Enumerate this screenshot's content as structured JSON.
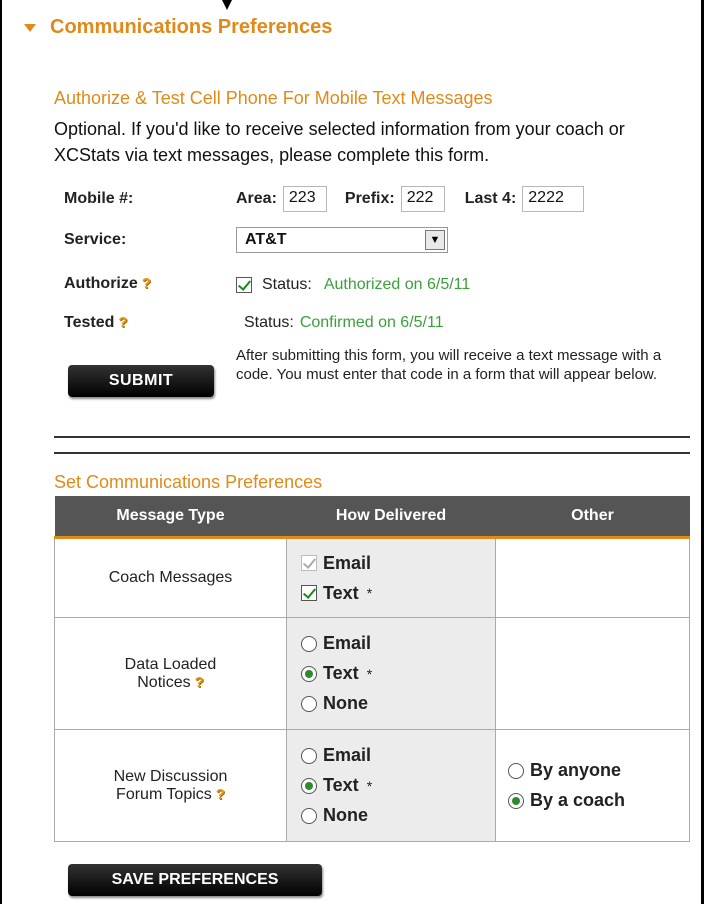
{
  "section": {
    "title": "Communications Preferences"
  },
  "phone": {
    "subtitle": "Authorize & Test Cell Phone For Mobile Text Messages",
    "intro": "Optional. If you'd like to receive selected information from your coach or XCStats via text messages, please complete this form.",
    "mobile_label": "Mobile #:",
    "area_label": "Area:",
    "area_value": "223",
    "prefix_label": "Prefix:",
    "prefix_value": "222",
    "last4_label": "Last 4:",
    "last4_value": "2222",
    "service_label": "Service:",
    "service_value": "AT&T",
    "authorize_label": "Authorize",
    "authorize_status_label": "Status:",
    "authorize_status_value": "Authorized on 6/5/11",
    "tested_label": "Tested",
    "tested_status_label": "Status:",
    "tested_status_value": "Confirmed on 6/5/11",
    "submit_label": "SUBMIT",
    "submit_note": "After submitting this form, you will receive a text message with a code. You must enter that code in a form that will appear below."
  },
  "prefs": {
    "subtitle": "Set Communications Preferences",
    "headers": [
      "Message Type",
      "How Delivered",
      "Other"
    ],
    "rows": [
      {
        "type": "Coach Messages",
        "options": [
          "Email",
          "Text"
        ]
      },
      {
        "type_line1": "Data Loaded",
        "type_line2": "Notices",
        "options": [
          "Email",
          "Text",
          "None"
        ]
      },
      {
        "type_line1": "New Discussion",
        "type_line2": "Forum Topics",
        "options": [
          "Email",
          "Text",
          "None"
        ],
        "other": [
          "By anyone",
          "By a coach"
        ]
      }
    ],
    "star": "*",
    "save_label": "SAVE PREFERENCES"
  },
  "colors": {
    "accent": "#e08a1a",
    "header_bg": "#555555",
    "status_green": "#3aa13a"
  },
  "icons": {
    "help": "help-question-icon",
    "caret": "caret-down-icon"
  }
}
